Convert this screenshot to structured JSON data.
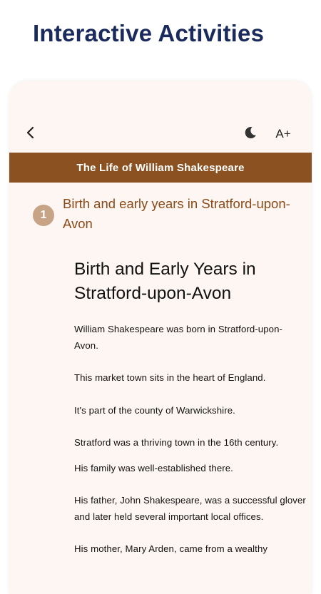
{
  "header": {
    "title": "Interactive Activities"
  },
  "toolbar": {
    "back_icon": "chevron-left-icon",
    "theme_icon": "moon-icon",
    "font_size_label": "A+"
  },
  "book": {
    "title": "The Life of William Shakespeare"
  },
  "chapter": {
    "number": "1",
    "title": "Birth and early years in Stratford-upon-Avon"
  },
  "content": {
    "heading": "Birth and Early Years in Stratford-upon-Avon",
    "paragraphs": [
      "William Shakespeare was born in Stratford-upon-Avon.",
      "This market town sits in the heart of England.",
      "It's part of the county of Warwickshire.",
      "Stratford was a thriving town in the 16th century.",
      "His family was well-established there.",
      "His father, John Shakespeare, was a successful glover and later held several important local offices.",
      "His mother, Mary Arden, came from a wealthy"
    ]
  },
  "colors": {
    "title_navy": "#1b2a5c",
    "title_bar_brown": "#8b5120",
    "chapter_title": "#8b4a16",
    "chapter_badge": "#c8a487",
    "card_background": "#fef6f3"
  }
}
